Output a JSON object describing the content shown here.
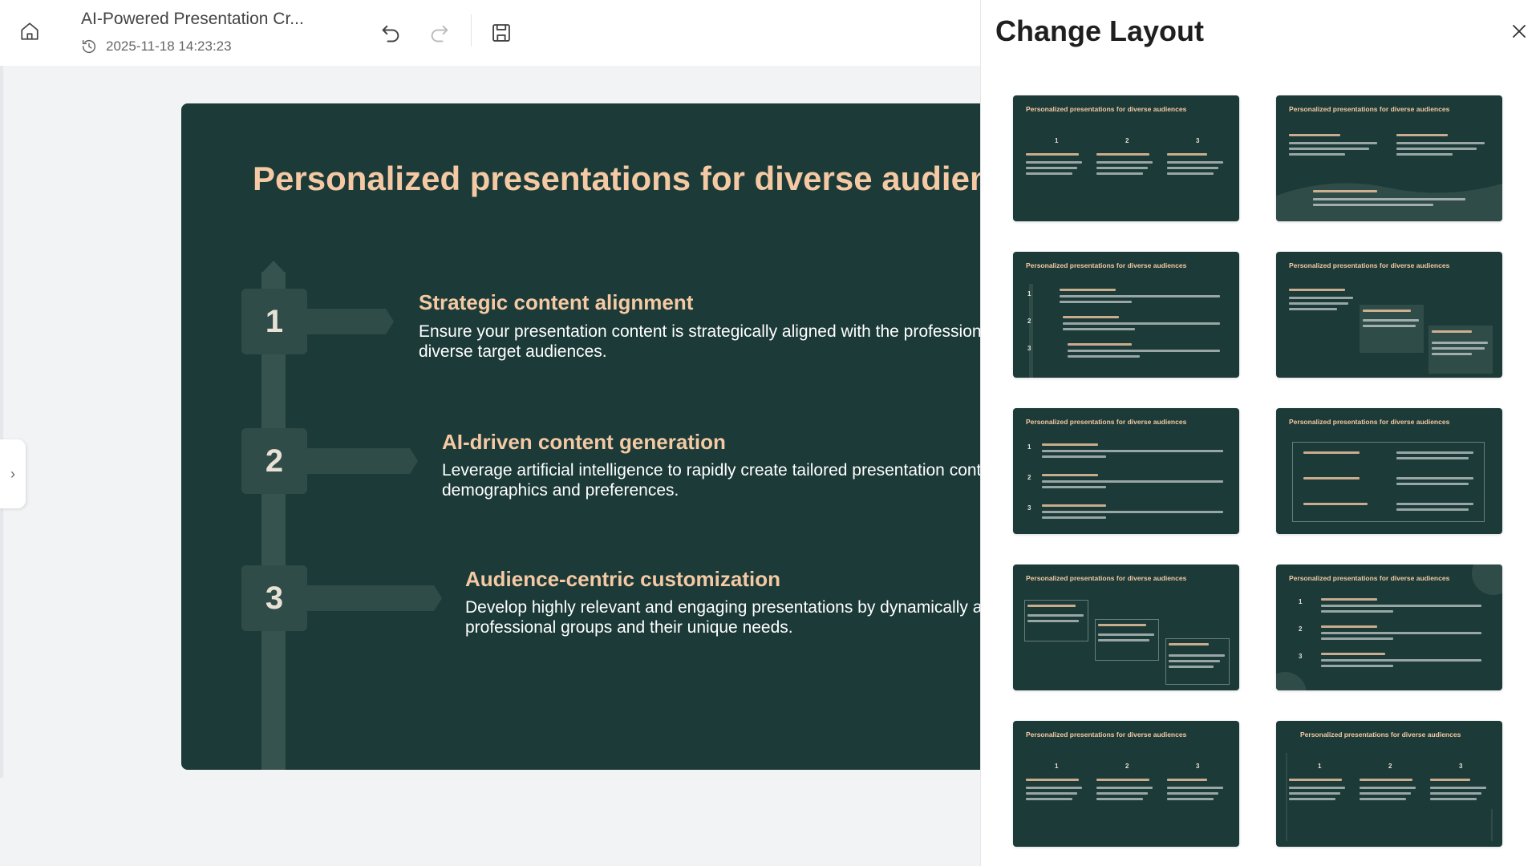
{
  "header": {
    "doc_title": "AI-Powered Presentation Cr...",
    "timestamp": "2025-11-18 14:23:23"
  },
  "slide": {
    "title": "Personalized presentations for diverse audiences",
    "steps": [
      {
        "number": "1",
        "title": "Strategic content alignment",
        "desc_line1": "Ensure your presentation content is strategically aligned with the professional",
        "desc_line2": "diverse target audiences."
      },
      {
        "number": "2",
        "title": "AI-driven content generation",
        "desc_line1": "Leverage artificial intelligence to rapidly create tailored presentation content",
        "desc_line2": "demographics and preferences."
      },
      {
        "number": "3",
        "title": "Audience-centric customization",
        "desc_line1": "Develop highly relevant and engaging presentations by dynamically adjusting",
        "desc_line2": "professional groups and their unique needs."
      }
    ]
  },
  "panel": {
    "title": "Change Layout",
    "thumb_title": "Personalized presentations for diverse audiences",
    "thumb_numbers": [
      "1",
      "2",
      "3"
    ]
  },
  "icons": {
    "home": "home-icon",
    "history": "clock-history-icon",
    "undo": "undo-icon",
    "redo": "redo-icon",
    "save": "save-icon",
    "close": "close-icon",
    "expand": "chevron-right-icon"
  },
  "colors": {
    "slide_bg": "#1b3a38",
    "accent": "#f4c9a3",
    "step_block": "#2f4c48"
  }
}
